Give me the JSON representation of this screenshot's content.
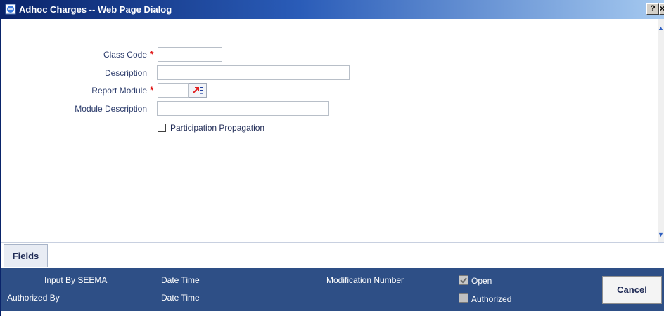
{
  "window": {
    "title": "Adhoc Charges -- Web Page Dialog",
    "help_label": "?",
    "close_label": "×"
  },
  "form": {
    "class_code": {
      "label": "Class Code",
      "value": ""
    },
    "description": {
      "label": "Description",
      "value": ""
    },
    "report_module": {
      "label": "Report Module",
      "value": ""
    },
    "module_description": {
      "label": "Module Description",
      "value": ""
    },
    "participation": {
      "label": "Participation Propagation",
      "checked": false
    },
    "required_mark": "*"
  },
  "tabs": [
    {
      "label": "Fields"
    }
  ],
  "audit": {
    "input_by": "Input By SEEMA",
    "authorized_by": "Authorized By",
    "date_time_1": "Date Time",
    "date_time_2": "Date Time",
    "modification_number": "Modification Number",
    "open": {
      "label": "Open",
      "checked": true
    },
    "authorized": {
      "label": "Authorized",
      "checked": false
    }
  },
  "buttons": {
    "cancel": "Cancel"
  },
  "colors": {
    "title_bar": "#0a246a",
    "audit_bar": "#2e4f86",
    "required": "#e01010"
  }
}
